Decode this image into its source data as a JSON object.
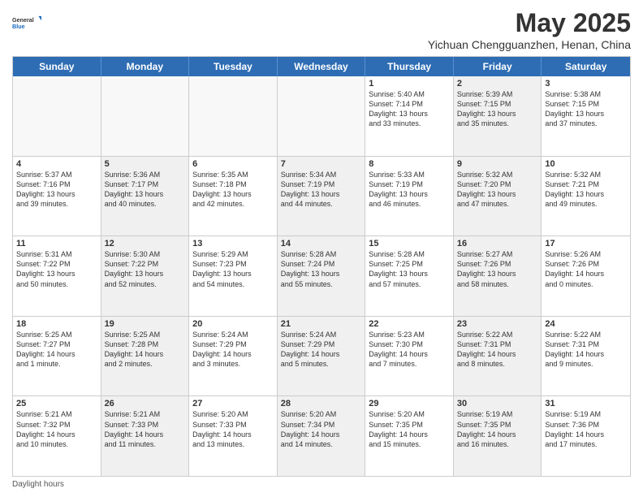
{
  "header": {
    "logo_general": "General",
    "logo_blue": "Blue",
    "main_title": "May 2025",
    "subtitle": "Yichuan Chengguanzhen, Henan, China"
  },
  "calendar": {
    "days": [
      "Sunday",
      "Monday",
      "Tuesday",
      "Wednesday",
      "Thursday",
      "Friday",
      "Saturday"
    ],
    "rows": [
      [
        {
          "day": "",
          "text": "",
          "empty": true
        },
        {
          "day": "",
          "text": "",
          "empty": true
        },
        {
          "day": "",
          "text": "",
          "empty": true
        },
        {
          "day": "",
          "text": "",
          "empty": true
        },
        {
          "day": "1",
          "text": "Sunrise: 5:40 AM\nSunset: 7:14 PM\nDaylight: 13 hours\nand 33 minutes.",
          "empty": false
        },
        {
          "day": "2",
          "text": "Sunrise: 5:39 AM\nSunset: 7:15 PM\nDaylight: 13 hours\nand 35 minutes.",
          "empty": false,
          "shaded": true
        },
        {
          "day": "3",
          "text": "Sunrise: 5:38 AM\nSunset: 7:15 PM\nDaylight: 13 hours\nand 37 minutes.",
          "empty": false
        }
      ],
      [
        {
          "day": "4",
          "text": "Sunrise: 5:37 AM\nSunset: 7:16 PM\nDaylight: 13 hours\nand 39 minutes.",
          "empty": false
        },
        {
          "day": "5",
          "text": "Sunrise: 5:36 AM\nSunset: 7:17 PM\nDaylight: 13 hours\nand 40 minutes.",
          "empty": false,
          "shaded": true
        },
        {
          "day": "6",
          "text": "Sunrise: 5:35 AM\nSunset: 7:18 PM\nDaylight: 13 hours\nand 42 minutes.",
          "empty": false
        },
        {
          "day": "7",
          "text": "Sunrise: 5:34 AM\nSunset: 7:19 PM\nDaylight: 13 hours\nand 44 minutes.",
          "empty": false,
          "shaded": true
        },
        {
          "day": "8",
          "text": "Sunrise: 5:33 AM\nSunset: 7:19 PM\nDaylight: 13 hours\nand 46 minutes.",
          "empty": false
        },
        {
          "day": "9",
          "text": "Sunrise: 5:32 AM\nSunset: 7:20 PM\nDaylight: 13 hours\nand 47 minutes.",
          "empty": false,
          "shaded": true
        },
        {
          "day": "10",
          "text": "Sunrise: 5:32 AM\nSunset: 7:21 PM\nDaylight: 13 hours\nand 49 minutes.",
          "empty": false
        }
      ],
      [
        {
          "day": "11",
          "text": "Sunrise: 5:31 AM\nSunset: 7:22 PM\nDaylight: 13 hours\nand 50 minutes.",
          "empty": false
        },
        {
          "day": "12",
          "text": "Sunrise: 5:30 AM\nSunset: 7:22 PM\nDaylight: 13 hours\nand 52 minutes.",
          "empty": false,
          "shaded": true
        },
        {
          "day": "13",
          "text": "Sunrise: 5:29 AM\nSunset: 7:23 PM\nDaylight: 13 hours\nand 54 minutes.",
          "empty": false
        },
        {
          "day": "14",
          "text": "Sunrise: 5:28 AM\nSunset: 7:24 PM\nDaylight: 13 hours\nand 55 minutes.",
          "empty": false,
          "shaded": true
        },
        {
          "day": "15",
          "text": "Sunrise: 5:28 AM\nSunset: 7:25 PM\nDaylight: 13 hours\nand 57 minutes.",
          "empty": false
        },
        {
          "day": "16",
          "text": "Sunrise: 5:27 AM\nSunset: 7:26 PM\nDaylight: 13 hours\nand 58 minutes.",
          "empty": false,
          "shaded": true
        },
        {
          "day": "17",
          "text": "Sunrise: 5:26 AM\nSunset: 7:26 PM\nDaylight: 14 hours\nand 0 minutes.",
          "empty": false
        }
      ],
      [
        {
          "day": "18",
          "text": "Sunrise: 5:25 AM\nSunset: 7:27 PM\nDaylight: 14 hours\nand 1 minute.",
          "empty": false
        },
        {
          "day": "19",
          "text": "Sunrise: 5:25 AM\nSunset: 7:28 PM\nDaylight: 14 hours\nand 2 minutes.",
          "empty": false,
          "shaded": true
        },
        {
          "day": "20",
          "text": "Sunrise: 5:24 AM\nSunset: 7:29 PM\nDaylight: 14 hours\nand 3 minutes.",
          "empty": false
        },
        {
          "day": "21",
          "text": "Sunrise: 5:24 AM\nSunset: 7:29 PM\nDaylight: 14 hours\nand 5 minutes.",
          "empty": false,
          "shaded": true
        },
        {
          "day": "22",
          "text": "Sunrise: 5:23 AM\nSunset: 7:30 PM\nDaylight: 14 hours\nand 7 minutes.",
          "empty": false
        },
        {
          "day": "23",
          "text": "Sunrise: 5:22 AM\nSunset: 7:31 PM\nDaylight: 14 hours\nand 8 minutes.",
          "empty": false,
          "shaded": true
        },
        {
          "day": "24",
          "text": "Sunrise: 5:22 AM\nSunset: 7:31 PM\nDaylight: 14 hours\nand 9 minutes.",
          "empty": false
        }
      ],
      [
        {
          "day": "25",
          "text": "Sunrise: 5:21 AM\nSunset: 7:32 PM\nDaylight: 14 hours\nand 10 minutes.",
          "empty": false
        },
        {
          "day": "26",
          "text": "Sunrise: 5:21 AM\nSunset: 7:33 PM\nDaylight: 14 hours\nand 11 minutes.",
          "empty": false,
          "shaded": true
        },
        {
          "day": "27",
          "text": "Sunrise: 5:20 AM\nSunset: 7:33 PM\nDaylight: 14 hours\nand 13 minutes.",
          "empty": false
        },
        {
          "day": "28",
          "text": "Sunrise: 5:20 AM\nSunset: 7:34 PM\nDaylight: 14 hours\nand 14 minutes.",
          "empty": false,
          "shaded": true
        },
        {
          "day": "29",
          "text": "Sunrise: 5:20 AM\nSunset: 7:35 PM\nDaylight: 14 hours\nand 15 minutes.",
          "empty": false
        },
        {
          "day": "30",
          "text": "Sunrise: 5:19 AM\nSunset: 7:35 PM\nDaylight: 14 hours\nand 16 minutes.",
          "empty": false,
          "shaded": true
        },
        {
          "day": "31",
          "text": "Sunrise: 5:19 AM\nSunset: 7:36 PM\nDaylight: 14 hours\nand 17 minutes.",
          "empty": false
        }
      ]
    ]
  },
  "footer": {
    "text": "Daylight hours"
  }
}
